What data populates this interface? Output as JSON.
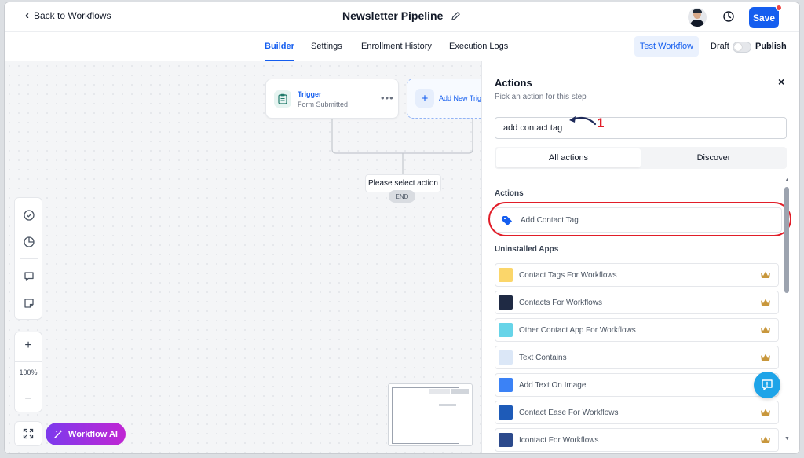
{
  "header": {
    "back_label": "Back to Workflows",
    "workflow_name": "Newsletter Pipeline",
    "save_label": "Save"
  },
  "tabs": [
    {
      "label": "Builder",
      "active": true
    },
    {
      "label": "Settings",
      "active": false
    },
    {
      "label": "Enrollment History",
      "active": false
    },
    {
      "label": "Execution Logs",
      "active": false
    }
  ],
  "toolbar": {
    "test_label": "Test Workflow",
    "draft_label": "Draft",
    "publish_label": "Publish",
    "publish_on": false
  },
  "canvas": {
    "trigger": {
      "title": "Trigger",
      "subtitle": "Form Submitted",
      "more": "•••"
    },
    "add_trigger_label": "Add New Trigger",
    "select_action_label": "Please select action",
    "end_label": "END",
    "zoom_plus": "+",
    "zoom_level": "100%",
    "zoom_minus": "−",
    "ai_label": "Workflow AI"
  },
  "panel": {
    "title": "Actions",
    "subtitle": "Pick an action for this step",
    "close": "×",
    "search_value": "add contact tag",
    "annotation_number": "1",
    "segments": [
      {
        "label": "All actions",
        "active": true
      },
      {
        "label": "Discover",
        "active": false
      }
    ],
    "actions_heading": "Actions",
    "action_result": "Add Contact Tag",
    "uninstalled_heading": "Uninstalled Apps",
    "apps": [
      {
        "label": "Contact Tags For Workflows",
        "icon": "tags-app-icon",
        "color": "#fbd66a"
      },
      {
        "label": "Contacts For Workflows",
        "icon": "contacts-app-icon",
        "color": "#1f2a44"
      },
      {
        "label": "Other Contact App For Workflows",
        "icon": "other-contact-app-icon",
        "color": "#67d4e8"
      },
      {
        "label": "Text Contains",
        "icon": "text-contains-app-icon",
        "color": "#dbe7f7"
      },
      {
        "label": "Add Text On Image",
        "icon": "text-on-image-app-icon",
        "color": "#3b82f6"
      },
      {
        "label": "Contact Ease For Workflows",
        "icon": "contact-ease-app-icon",
        "color": "#1e5bb8"
      },
      {
        "label": "Icontact For Workflows",
        "icon": "icontact-app-icon",
        "color": "#2c4a8c"
      }
    ]
  },
  "colors": {
    "primary": "#155eef",
    "highlight": "#e11d28",
    "ai_gradient_start": "#7c3aed",
    "ai_gradient_end": "#c026d3",
    "crown": "#c8973c"
  }
}
